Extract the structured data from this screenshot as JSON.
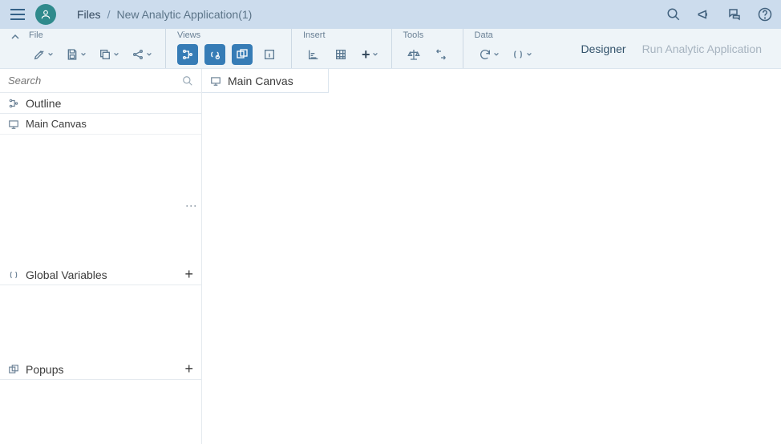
{
  "breadcrumb": {
    "root": "Files",
    "current": "New Analytic Application(1)"
  },
  "toolbar": {
    "groups": {
      "file": "File",
      "views": "Views",
      "insert": "Insert",
      "tools": "Tools",
      "data": "Data"
    }
  },
  "modes": {
    "designer": "Designer",
    "run": "Run Analytic Application"
  },
  "search": {
    "placeholder": "Search"
  },
  "panels": {
    "outline": {
      "title": "Outline",
      "items": [
        {
          "label": "Main Canvas"
        }
      ]
    },
    "global": {
      "title": "Global Variables"
    },
    "popups": {
      "title": "Popups"
    }
  },
  "canvas": {
    "tab": "Main Canvas"
  }
}
